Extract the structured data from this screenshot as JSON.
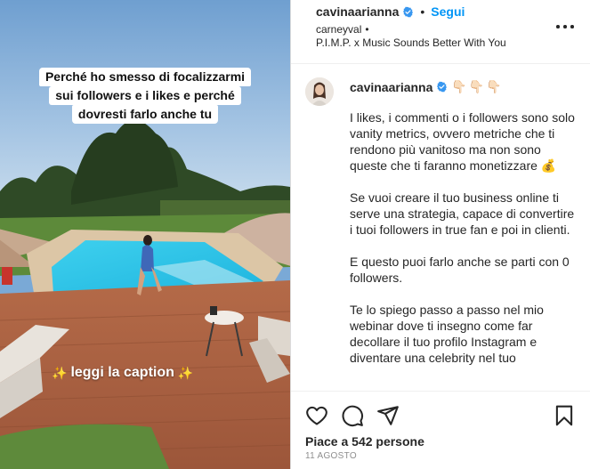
{
  "media": {
    "overlay_lines": [
      "Perché ho smesso di focalizzarmi",
      "sui followers e i likes e perché",
      "dovresti farlo anche tu"
    ],
    "leggi_text": "leggi la caption",
    "sparkle_left": "✨",
    "sparkle_right": "✨"
  },
  "header": {
    "username": "cavinaarianna",
    "separator": "•",
    "follow_label": "Segui",
    "location": "carneyval",
    "location_sep": "•",
    "audio": "P.I.M.P. x Music Sounds Better With You",
    "more_icon": "more-horizontal-icon"
  },
  "caption": {
    "username": "cavinaarianna",
    "hand_emojis": "👇🏻👇🏻👇🏻",
    "paragraphs": [
      "I likes, i commenti o i followers sono solo vanity metrics, ovvero metriche che ti rendono più vanitoso ma non sono queste che ti faranno monetizzare 💰",
      "Se vuoi creare il tuo business online ti serve una strategia, capace di convertire i tuoi followers in true fan e poi in clienti.",
      "E questo puoi farlo anche se parti con 0 followers.",
      "Te lo spiego passo a passo nel mio webinar dove ti insegno come far decollare il tuo profilo Instagram e diventare una celebrity nel tuo"
    ]
  },
  "actions": {
    "like_icon": "heart-icon",
    "comment_icon": "comment-icon",
    "share_icon": "share-icon",
    "save_icon": "bookmark-icon",
    "likes_text": "Piace a 542 persone",
    "date_text": "11 AGOSTO"
  },
  "colors": {
    "accent": "#0095f6",
    "verified": "#3897f0",
    "text": "#262626",
    "muted": "#8e8e8e",
    "border": "#dbdbdb"
  }
}
